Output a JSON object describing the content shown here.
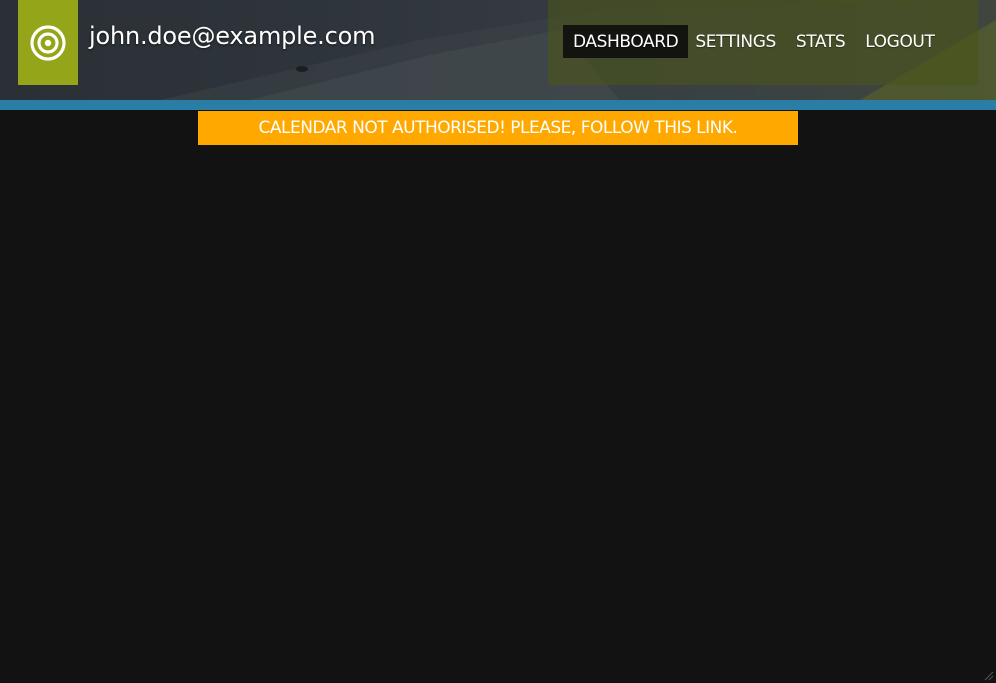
{
  "header": {
    "user_email": "john.doe@example.com",
    "logo_icon": "target-icon",
    "logo_color": "#94a51a",
    "stripe_color": "#2a7ea6"
  },
  "nav": {
    "items": [
      {
        "label": "DASHBOARD",
        "active": true
      },
      {
        "label": "SETTINGS",
        "active": false
      },
      {
        "label": "STATS",
        "active": false
      },
      {
        "label": "LOGOUT",
        "active": false
      }
    ]
  },
  "banner": {
    "text": "CALENDAR NOT AUTHORISED! PLEASE, FOLLOW THIS LINK.",
    "color": "#ffa800"
  }
}
